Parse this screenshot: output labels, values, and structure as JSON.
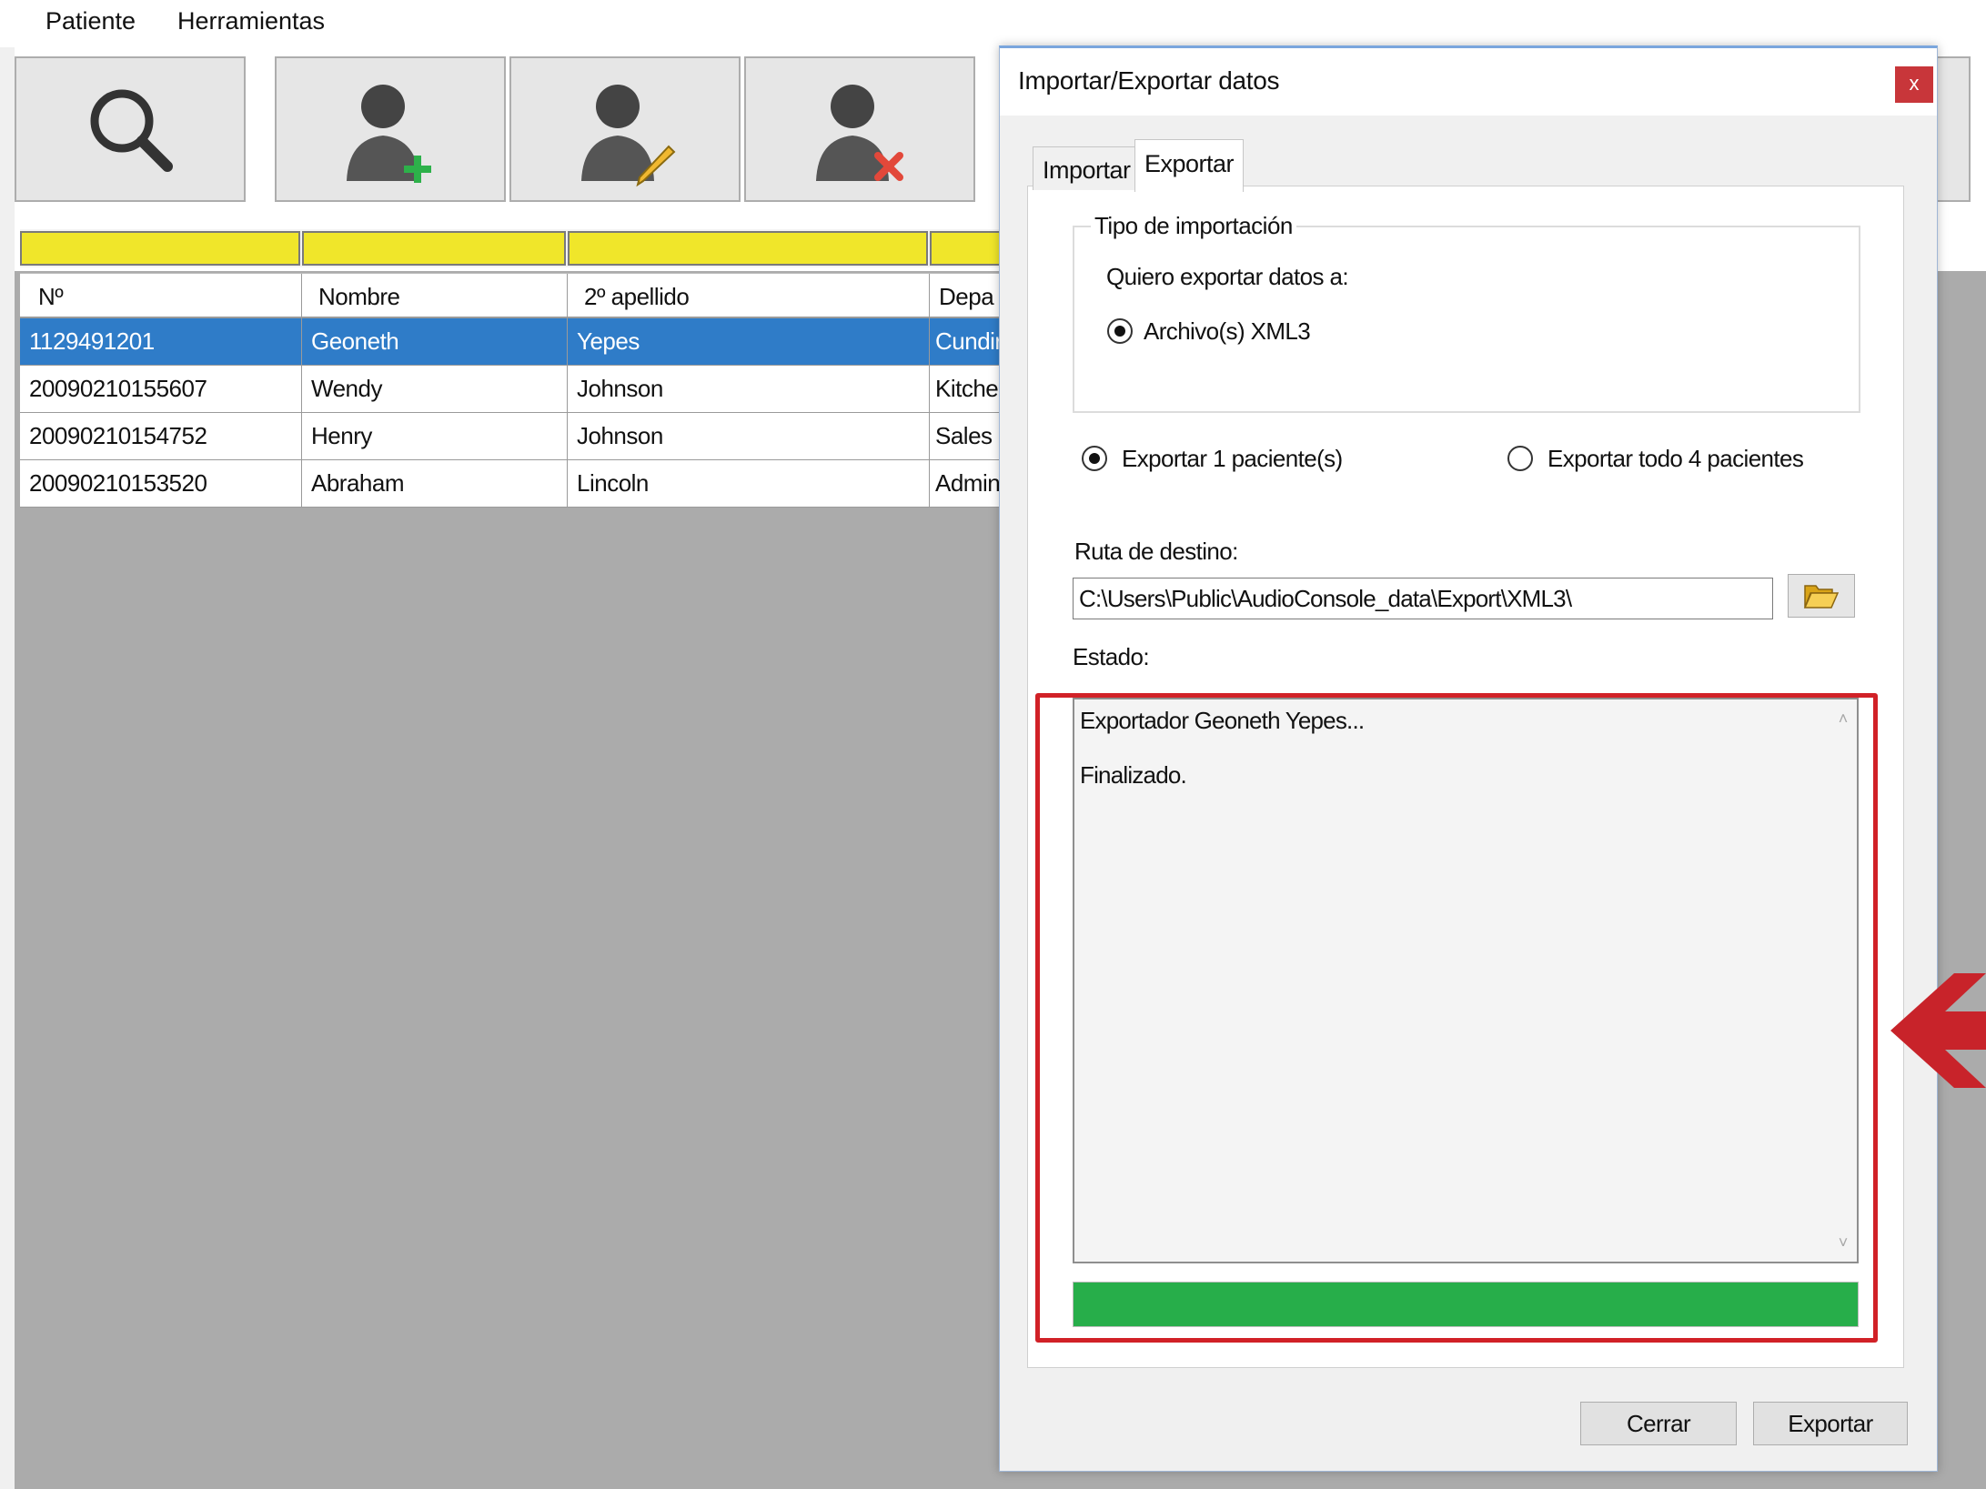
{
  "menubar": {
    "items": [
      "Patiente",
      "Herramientas"
    ]
  },
  "toolbar": {
    "buttons": [
      {
        "name": "search",
        "icon": "search-icon"
      },
      {
        "name": "add-patient",
        "icon": "user-add-icon"
      },
      {
        "name": "edit-patient",
        "icon": "user-edit-icon"
      },
      {
        "name": "delete-patient",
        "icon": "user-delete-icon"
      }
    ]
  },
  "grid": {
    "columns": [
      "Nº",
      "Nombre",
      "2º apellido",
      "Depa"
    ],
    "rows": [
      {
        "no": "1129491201",
        "nombre": "Geoneth",
        "apellido": "Yepes",
        "depa": "Cundir",
        "selected": true
      },
      {
        "no": "20090210155607",
        "nombre": "Wendy",
        "apellido": "Johnson",
        "depa": "Kitche"
      },
      {
        "no": "20090210154752",
        "nombre": "Henry",
        "apellido": "Johnson",
        "depa": "Sales"
      },
      {
        "no": "20090210153520",
        "nombre": "Abraham",
        "apellido": "Lincoln",
        "depa": "Admin"
      }
    ]
  },
  "dialog": {
    "title": "Importar/Exportar datos",
    "close_label": "x",
    "tabs": [
      "Importar",
      "Exportar"
    ],
    "active_tab": "Exportar",
    "group_title": "Tipo de importación",
    "export_to_label": "Quiero exportar datos a:",
    "format_option": "Archivo(s) XML3",
    "export_selected_option": "Exportar 1 paciente(s)",
    "export_all_option": "Exportar todo 4 pacientes",
    "destination_label": "Ruta de destino:",
    "destination_path": "C:\\Users\\Public\\AudioConsole_data\\Export\\XML3\\",
    "status_label": "Estado:",
    "status_lines": [
      "Exportador Geoneth Yepes...",
      "Finalizado."
    ],
    "progress_fraction": 1.0,
    "buttons": {
      "close": "Cerrar",
      "export": "Exportar"
    }
  },
  "colors": {
    "selection": "#2f7cc8",
    "filter_row": "#f0e62a",
    "progress": "#27ae4a",
    "highlight": "#d12127"
  }
}
